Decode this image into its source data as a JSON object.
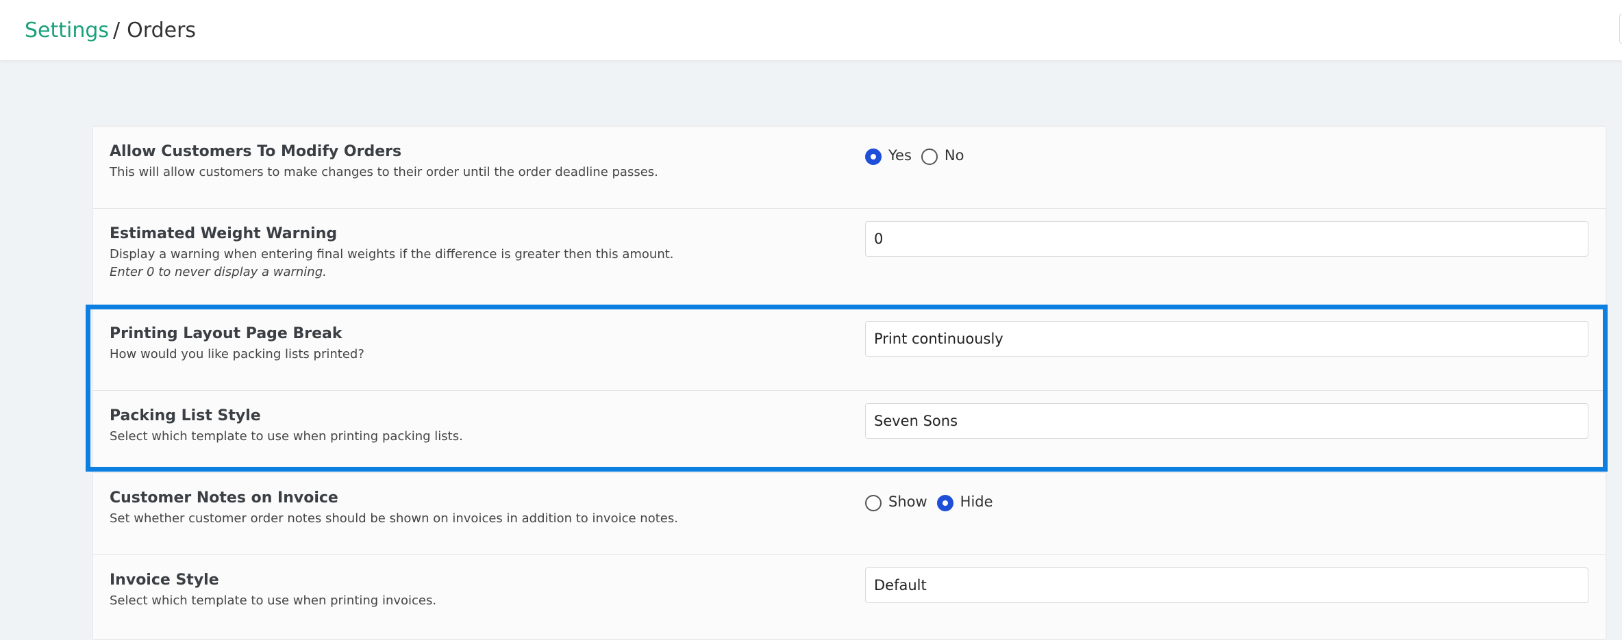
{
  "breadcrumb": {
    "parent": "Settings",
    "separator": "/",
    "current": "Orders"
  },
  "settings": {
    "modify_orders": {
      "title": "Allow Customers To Modify Orders",
      "description": "This will allow customers to make changes to their order until the order deadline passes.",
      "options": [
        "Yes",
        "No"
      ],
      "selected": "Yes"
    },
    "weight_warning": {
      "title": "Estimated Weight Warning",
      "description": "Display a warning when entering final weights if the difference is greater then this amount.",
      "hint": "Enter 0 to never display a warning.",
      "value": "0"
    },
    "page_break": {
      "title": "Printing Layout Page Break",
      "description": "How would you like packing lists printed?",
      "value": "Print continuously"
    },
    "packing_style": {
      "title": "Packing List Style",
      "description": "Select which template to use when printing packing lists.",
      "value": "Seven Sons"
    },
    "customer_notes": {
      "title": "Customer Notes on Invoice",
      "description": "Set whether customer order notes should be shown on invoices in addition to invoice notes.",
      "options": [
        "Show",
        "Hide"
      ],
      "selected": "Hide"
    },
    "invoice_style": {
      "title": "Invoice Style",
      "description": "Select which template to use when printing invoices.",
      "value": "Default"
    }
  },
  "colors": {
    "accent": "#1aa07a",
    "radio": "#1f4fd8",
    "highlight": "#0d7fe0"
  }
}
